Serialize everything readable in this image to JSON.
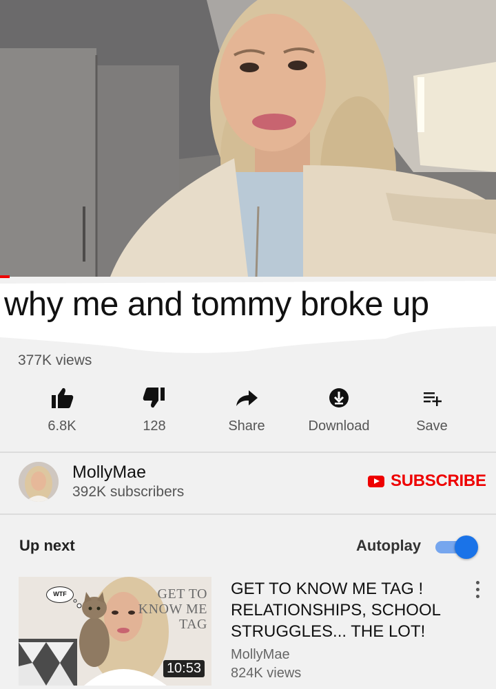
{
  "video": {
    "title": "why me and  tommy broke up",
    "views": "377K views",
    "progress_fraction": 0.02
  },
  "actions": [
    {
      "id": "like",
      "icon": "thumbs-up-icon",
      "label": "6.8K"
    },
    {
      "id": "dislike",
      "icon": "thumbs-down-icon",
      "label": "128"
    },
    {
      "id": "share",
      "icon": "share-arrow-icon",
      "label": "Share"
    },
    {
      "id": "download",
      "icon": "download-icon",
      "label": "Download"
    },
    {
      "id": "save",
      "icon": "playlist-add-icon",
      "label": "Save"
    }
  ],
  "channel": {
    "name": "MollyMae",
    "subscribers": "392K subscribers",
    "subscribe_label": "SUBSCRIBE"
  },
  "up_next": {
    "heading": "Up next",
    "autoplay_label": "Autoplay",
    "autoplay_on": true
  },
  "recommended": [
    {
      "title": "GET TO KNOW ME TAG ! RELATIONSHIPS, SCHOOL STRUGGLES... THE LOT!",
      "channel": "MollyMae",
      "views": "824K views",
      "duration": "10:53",
      "thumb_text": "GET TO KNOW ME TAG",
      "thumb_bubble": "WTF"
    }
  ],
  "colors": {
    "brand_red": "#ee0000",
    "autoplay_blue": "#1a73e8",
    "background": "#f1f1f1"
  }
}
